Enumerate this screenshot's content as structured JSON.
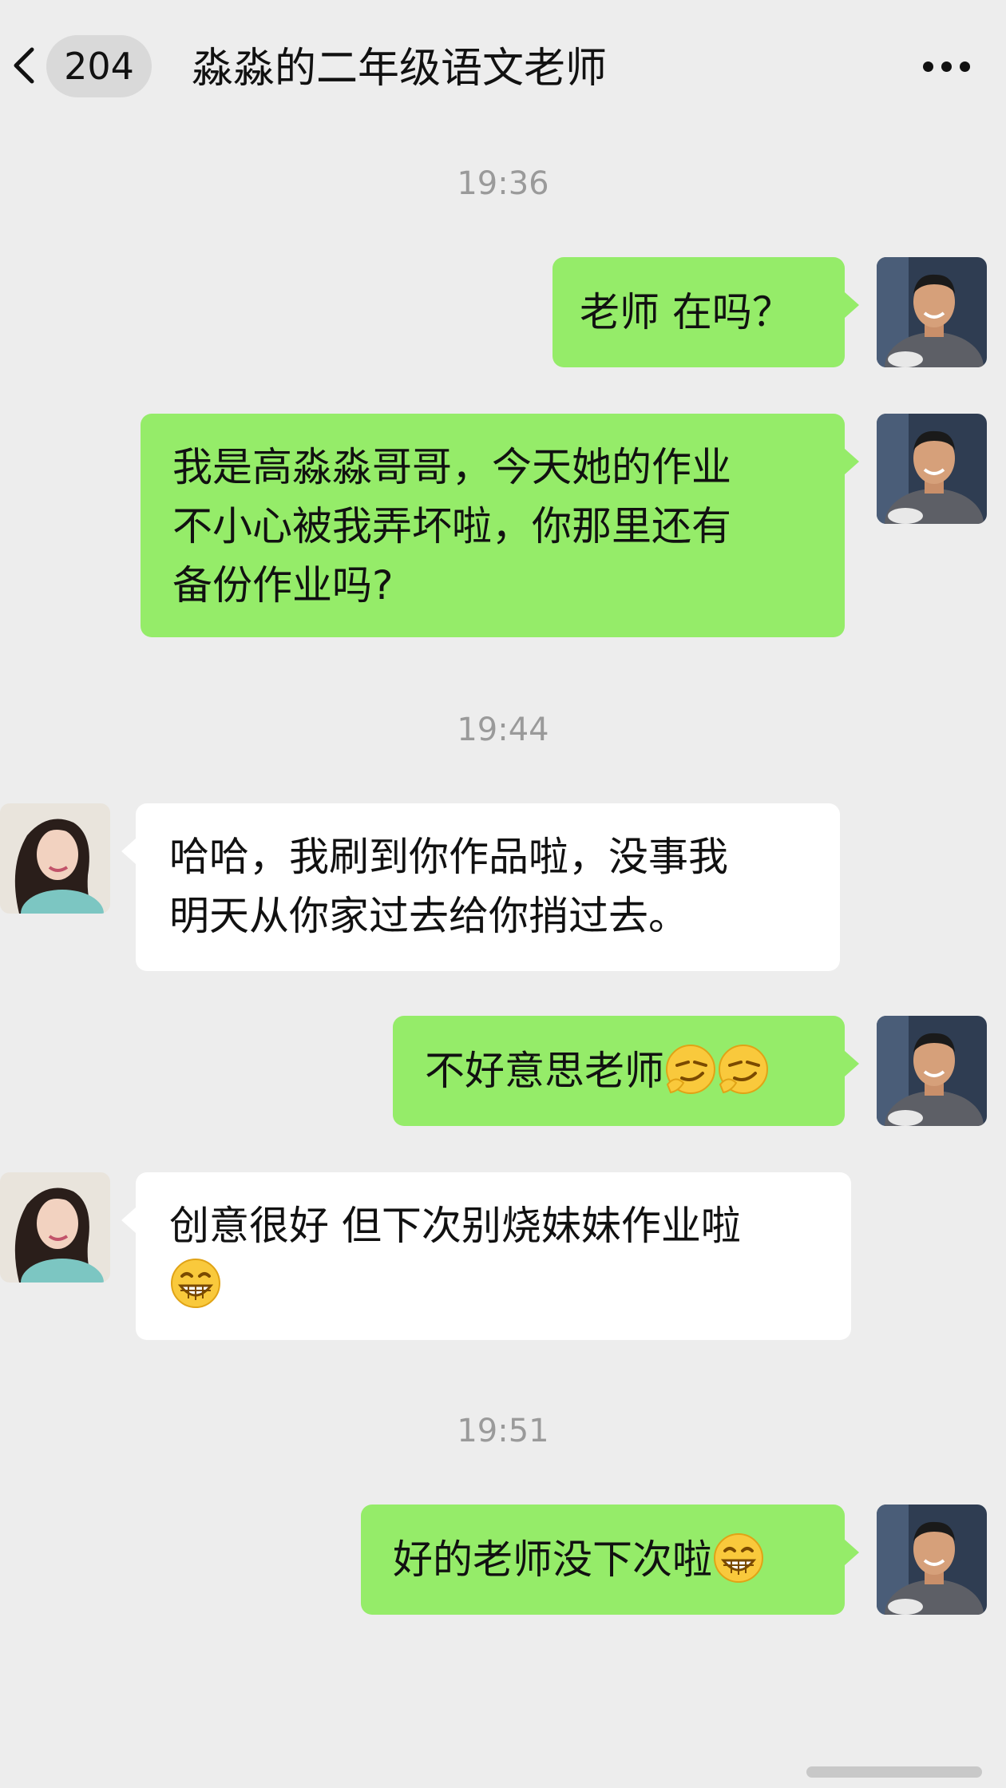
{
  "header": {
    "back_icon": "chevron-left-icon",
    "unread_count": "204",
    "title": "淼淼的二年级语文老师",
    "more_icon": "ellipsis-icon"
  },
  "timestamps": [
    "19:36",
    "19:44",
    "19:51"
  ],
  "messages": [
    {
      "sender": "me",
      "text": "老师 在吗？"
    },
    {
      "sender": "me",
      "text": "我是高淼淼哥哥，今天她的作业\n不小心被我弄坏啦，你那里还有\n备份作业吗?"
    },
    {
      "sender": "teacher",
      "text": "哈哈，我刷到你作品啦，没事我\n明天从你家过去给你捎过去。"
    },
    {
      "sender": "me",
      "text": "不好意思老师",
      "emojis": [
        "smirk-emoji",
        "smirk-emoji"
      ]
    },
    {
      "sender": "teacher",
      "text": "创意很好 但下次别烧妹妹作业啦\n",
      "emojis": [
        "grin-emoji"
      ]
    },
    {
      "sender": "me",
      "text": "好的老师没下次啦",
      "emojis": [
        "grin-emoji"
      ]
    }
  ],
  "colors": {
    "background": "#ededed",
    "sent_bubble": "#95ec69",
    "received_bubble": "#ffffff",
    "timestamp_text": "#9a9a9a"
  }
}
